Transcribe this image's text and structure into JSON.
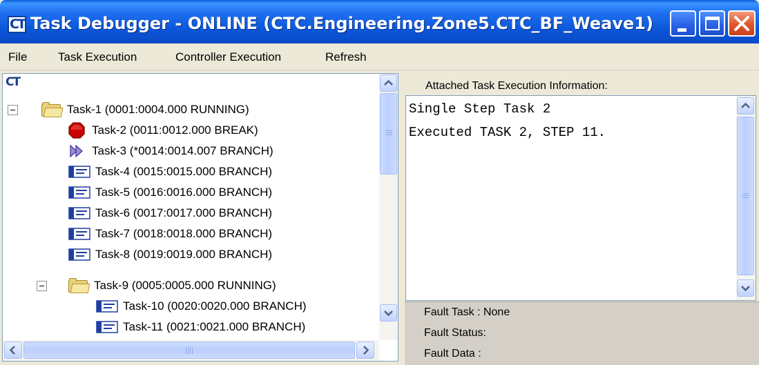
{
  "window": {
    "title": "Task Debugger - ONLINE (CTC.Engineering.Zone5.CTC_BF_Weave1)",
    "app_icon": "CT",
    "controls": [
      "minimize-icon",
      "maximize-icon",
      "close-icon"
    ]
  },
  "menu": [
    {
      "label": "File"
    },
    {
      "label": "Task Execution"
    },
    {
      "label": "Controller Execution"
    },
    {
      "label": "Refresh"
    }
  ],
  "tree": {
    "root_logo": "CT",
    "nodes": [
      {
        "label": "Task-1 (0001:0004.000 RUNNING)",
        "icon": "folder-icon",
        "expanded": true
      },
      {
        "label": "Task-2 (0011:0012.000 BREAK)",
        "icon": "stop-icon"
      },
      {
        "label": "Task-3 (*0014:0014.007 BRANCH)",
        "icon": "step-icon"
      },
      {
        "label": "Task-4 (0015:0015.000 BRANCH)",
        "icon": "branch-icon"
      },
      {
        "label": "Task-5 (0016:0016.000 BRANCH)",
        "icon": "branch-icon"
      },
      {
        "label": "Task-6 (0017:0017.000 BRANCH)",
        "icon": "branch-icon"
      },
      {
        "label": "Task-7 (0018:0018.000 BRANCH)",
        "icon": "branch-icon"
      },
      {
        "label": "Task-8 (0019:0019.000 BRANCH)",
        "icon": "branch-icon"
      },
      {
        "label": "Task-9 (0005:0005.000 RUNNING)",
        "icon": "folder-icon",
        "expanded": true
      },
      {
        "label": "Task-10 (0020:0020.000 BRANCH)",
        "icon": "branch-icon"
      },
      {
        "label": "Task-11 (0021:0021.000 BRANCH)",
        "icon": "branch-icon"
      }
    ]
  },
  "info": {
    "header": "Attached Task Execution Information:",
    "lines": [
      "Single Step Task 2",
      "Executed TASK 2, STEP 11."
    ]
  },
  "fault": {
    "task": "Fault Task : None",
    "status": "Fault Status:",
    "data": "Fault Data :"
  },
  "colors": {
    "title_bar": "#0b55d8",
    "close_button": "#e0552c",
    "stop_icon": "#cc0000",
    "window_bg": "#ece9d8"
  }
}
